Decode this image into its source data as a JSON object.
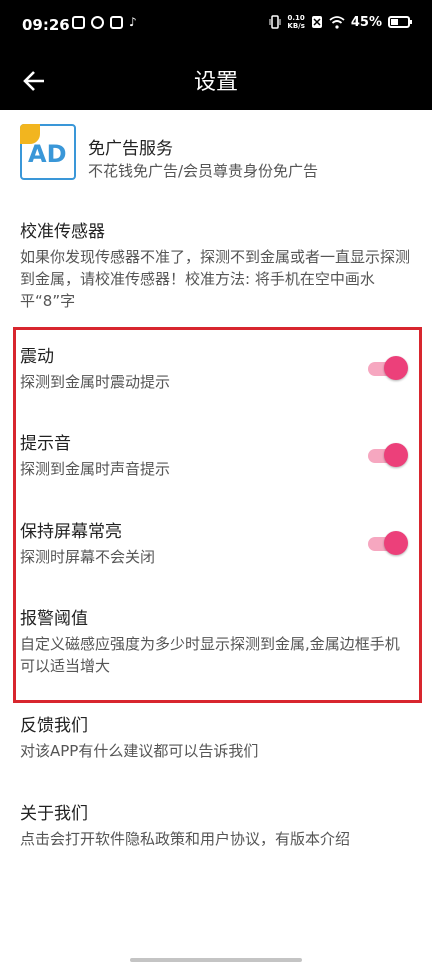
{
  "status_bar": {
    "time": "09:26",
    "speed_value": "0.10",
    "speed_unit": "KB/s",
    "battery_percent": "45%"
  },
  "header": {
    "title": "设置"
  },
  "ad_service": {
    "logo_text": "AD",
    "title": "免广告服务",
    "subtitle": "不花钱免广告/会员尊贵身份免广告"
  },
  "settings": {
    "calibrate": {
      "title": "校准传感器",
      "desc": "如果你发现传感器不准了，探测不到金属或者一直显示探测到金属，请校准传感器！校准方法: 将手机在空中画水平“8”字"
    },
    "vibrate": {
      "title": "震动",
      "desc": "探测到金属时震动提示",
      "enabled": true
    },
    "sound": {
      "title": "提示音",
      "desc": "探测到金属时声音提示",
      "enabled": true
    },
    "screen_on": {
      "title": "保持屏幕常亮",
      "desc": "探测时屏幕不会关闭",
      "enabled": true
    },
    "threshold": {
      "title": "报警阈值",
      "desc": "自定义磁感应强度为多少时显示探测到金属,金属边框手机可以适当增大"
    },
    "feedback": {
      "title": "反馈我们",
      "desc": "对该APP有什么建议都可以告诉我们"
    },
    "about": {
      "title": "关于我们",
      "desc": "点击会打开软件隐私政策和用户协议，有版本介绍"
    }
  },
  "colors": {
    "toggle_on": "#ec407a",
    "highlight_border": "#d8262e",
    "logo_blue": "#3a97d8"
  }
}
